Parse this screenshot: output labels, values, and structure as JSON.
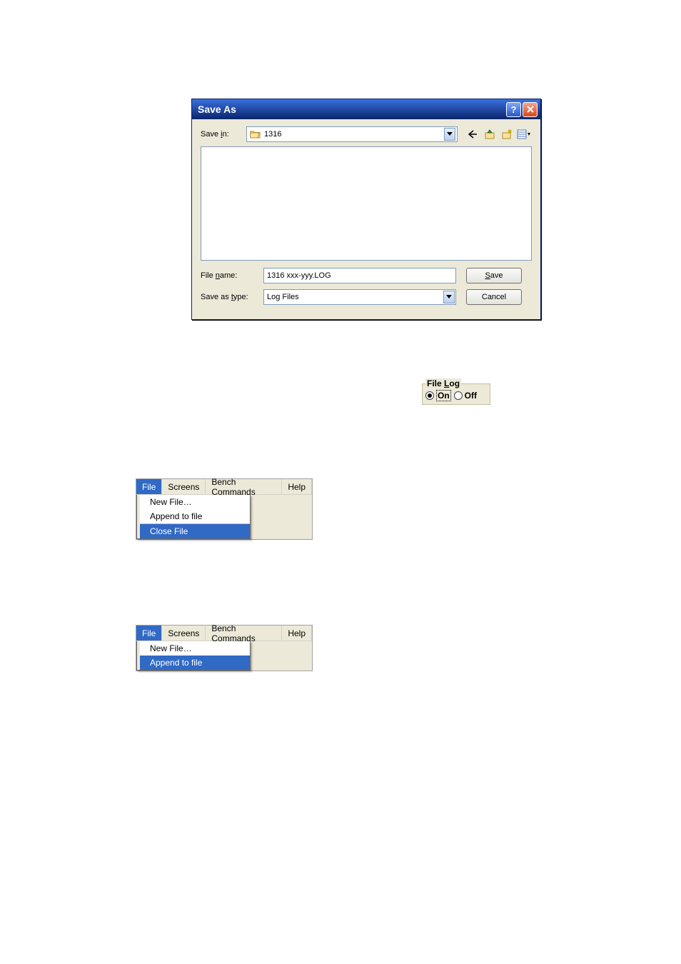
{
  "saveAs": {
    "title": "Save As",
    "saveInLabelPre": "Save ",
    "saveInLabelUL": "i",
    "saveInLabelPost": "n:",
    "folderName": "1316",
    "fileNameLabelPre": "File ",
    "fileNameLabelUL": "n",
    "fileNameLabelPost": "ame:",
    "fileNameValue": "1316 xxx-yyy.LOG",
    "saveAsTypeLabelPre": "Save as ",
    "saveAsTypeLabelUL": "t",
    "saveAsTypeLabelPost": "ype:",
    "saveAsTypeValue": "Log Files",
    "saveBtnUL": "S",
    "saveBtnRest": "ave",
    "cancelBtn": "Cancel",
    "icons": {
      "back": "back-icon",
      "up": "up-one-level-icon",
      "newFolder": "new-folder-icon",
      "views": "views-icon"
    }
  },
  "fileLog": {
    "legendPre": "File ",
    "legendUL": "L",
    "legendPost": "og",
    "onLabel": "On",
    "offLabel": "Off",
    "selected": "On"
  },
  "menu1": {
    "bar": {
      "file": "File",
      "screens": "Screens",
      "bench": "Bench Commands",
      "help": "Help"
    },
    "items": {
      "newFile": "New File…",
      "append": "Append to file",
      "close": "Close File"
    }
  },
  "menu2": {
    "bar": {
      "file": "File",
      "screens": "Screens",
      "bench": "Bench Commands",
      "help": "Help"
    },
    "items": {
      "newFile": "New File…",
      "append": "Append to file"
    }
  }
}
